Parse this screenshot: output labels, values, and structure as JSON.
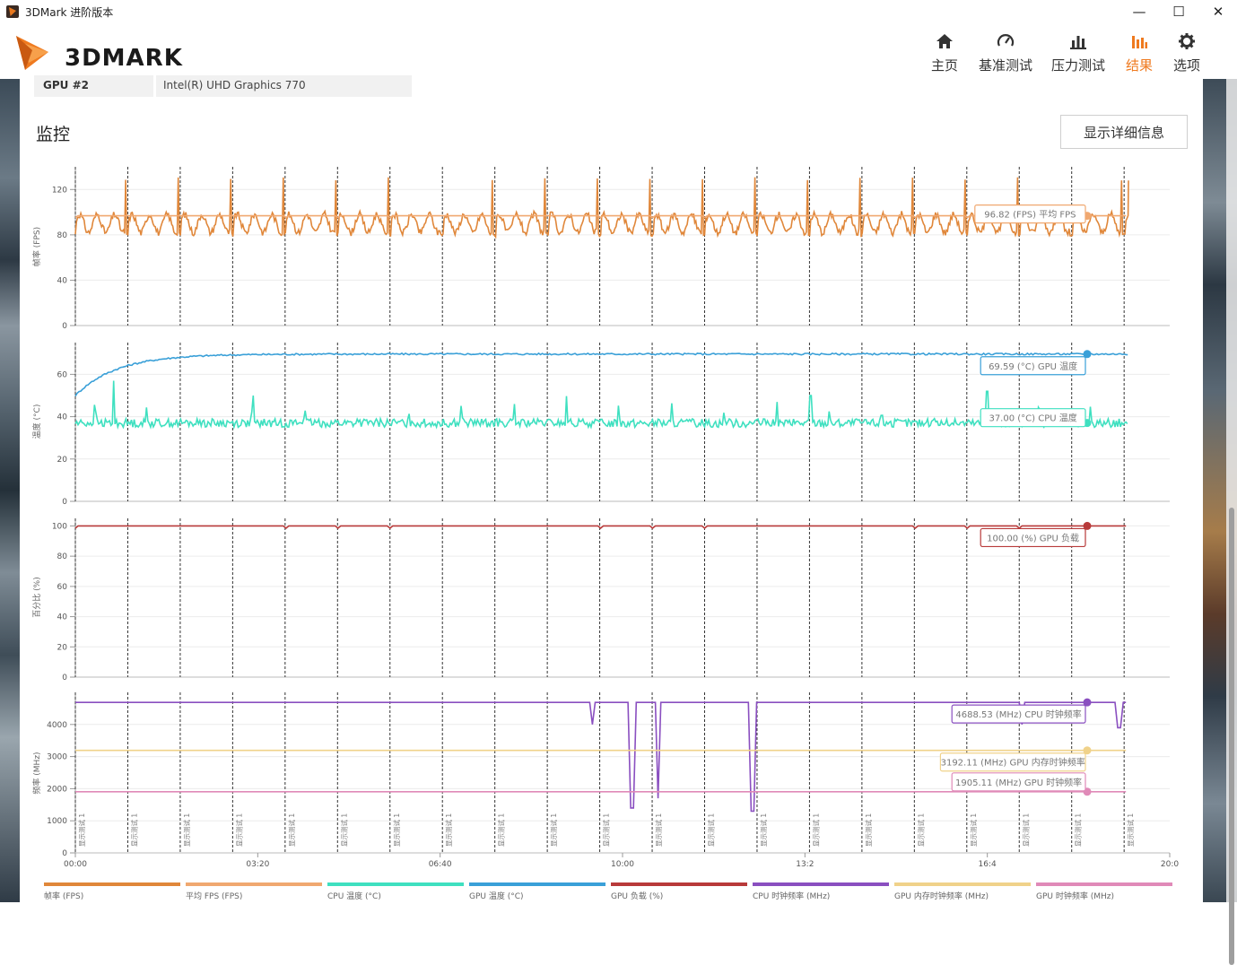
{
  "window": {
    "title": "3DMark 进阶版本",
    "controls": [
      "—",
      "☐",
      "✕"
    ]
  },
  "app": {
    "logo_text": "3DMARK"
  },
  "nav": [
    {
      "label": "主页",
      "icon": "home-icon",
      "active": false
    },
    {
      "label": "基准测试",
      "icon": "gauge-icon",
      "active": false
    },
    {
      "label": "压力测试",
      "icon": "bar-chart-icon",
      "active": false
    },
    {
      "label": "结果",
      "icon": "results-icon",
      "active": true
    },
    {
      "label": "选项",
      "icon": "gear-icon",
      "active": false
    }
  ],
  "gpu_row": {
    "key": "GPU #2",
    "value": "Intel(R) UHD Graphics 770"
  },
  "monitor": {
    "title": "监控",
    "detail_button": "显示详细信息"
  },
  "colors": {
    "fps": "#e0873a",
    "avg_fps": "#f0a870",
    "cpu_temp": "#3fe0c0",
    "gpu_temp": "#3aa0d8",
    "gpu_load": "#b83a3a",
    "cpu_clock": "#8a4fc0",
    "gpu_mem_clock": "#f0d28a",
    "gpu_clock": "#e08ab8"
  },
  "chart_data": [
    {
      "type": "line",
      "ylabel": "帧率 (FPS)",
      "ylim": [
        0,
        140
      ],
      "yticks": [
        0,
        40,
        80,
        120
      ],
      "xlim": [
        0,
        1200
      ],
      "series": [
        {
          "name": "帧率 (FPS)",
          "color": "#e0873a",
          "pattern": "fps_oscillating",
          "range": [
            78,
            131
          ]
        },
        {
          "name": "平均 FPS (FPS)",
          "color": "#f0a870",
          "constant": 96.82
        }
      ],
      "callouts": [
        {
          "text": "96.82 (FPS) 平均 FPS",
          "value": 96.82,
          "color": "#f0a870"
        }
      ]
    },
    {
      "type": "line",
      "ylabel": "温度 (°C)",
      "ylim": [
        0,
        75
      ],
      "yticks": [
        0,
        20,
        40,
        60
      ],
      "xlim": [
        0,
        1200
      ],
      "series": [
        {
          "name": "GPU 温度 (°C)",
          "color": "#3aa0d8",
          "start": 50,
          "plateau": 69.59
        },
        {
          "name": "CPU 温度 (°C)",
          "color": "#3fe0c0",
          "baseline": 37.0,
          "peaks": [
            57,
            52,
            50
          ]
        }
      ],
      "callouts": [
        {
          "text": "69.59 (°C) GPU 温度",
          "value": 69.59,
          "color": "#3aa0d8"
        },
        {
          "text": "37.00 (°C) CPU 温度",
          "value": 37.0,
          "color": "#3fe0c0"
        }
      ]
    },
    {
      "type": "line",
      "ylabel": "百分比 (%)",
      "ylim": [
        0,
        105
      ],
      "yticks": [
        0,
        20,
        40,
        60,
        80,
        100
      ],
      "xlim": [
        0,
        1200
      ],
      "series": [
        {
          "name": "GPU 负载 (%)",
          "color": "#b83a3a",
          "constant": 100.0
        }
      ],
      "callouts": [
        {
          "text": "100.00 (%) GPU 负载",
          "value": 100.0,
          "color": "#b83a3a"
        }
      ]
    },
    {
      "type": "line",
      "ylabel": "频率 (MHz)",
      "ylim": [
        0,
        5000
      ],
      "yticks": [
        0,
        1000,
        2000,
        3000,
        4000
      ],
      "xlim": [
        0,
        1200
      ],
      "xticks": [
        "00:00",
        "03:20",
        "06:40",
        "10:00",
        "13:20",
        "16:40",
        "20:00"
      ],
      "series": [
        {
          "name": "CPU 时钟频率 (MHz)",
          "color": "#8a4fc0",
          "constant": 4688.53
        },
        {
          "name": "GPU 内存时钟频率 (MHz)",
          "color": "#f0d28a",
          "constant": 3192.11
        },
        {
          "name": "GPU 时钟频率 (MHz)",
          "color": "#e08ab8",
          "constant": 1905.11
        }
      ],
      "callouts": [
        {
          "text": "4688.53 (MHz) CPU 时钟频率",
          "value": 4688.53,
          "color": "#8a4fc0"
        },
        {
          "text": "3192.11 (MHz) GPU 内存时钟频率",
          "value": 3192.11,
          "color": "#f0d28a"
        },
        {
          "text": "1905.11 (MHz) GPU 时钟频率",
          "value": 1905.11,
          "color": "#e08ab8"
        }
      ]
    }
  ],
  "markers": {
    "label": "显示测试 1",
    "count": 21
  },
  "xticks_visible": [
    "00:00",
    "03:20",
    "06:40",
    "10:00",
    "13:2",
    "16:4",
    "20:0"
  ],
  "legend": [
    {
      "label": "帧率 (FPS)",
      "color": "#e0873a"
    },
    {
      "label": "平均 FPS (FPS)",
      "color": "#f0a870"
    },
    {
      "label": "CPU 温度 (°C)",
      "color": "#3fe0c0"
    },
    {
      "label": "GPU 温度 (°C)",
      "color": "#3aa0d8"
    },
    {
      "label": "GPU 负载 (%)",
      "color": "#b83a3a"
    },
    {
      "label": "CPU 时钟频率 (MHz)",
      "color": "#8a4fc0"
    },
    {
      "label": "GPU 内存时钟频率 (MHz)",
      "color": "#f0d28a"
    },
    {
      "label": "GPU 时钟频率 (MHz)",
      "color": "#e08ab8"
    }
  ]
}
